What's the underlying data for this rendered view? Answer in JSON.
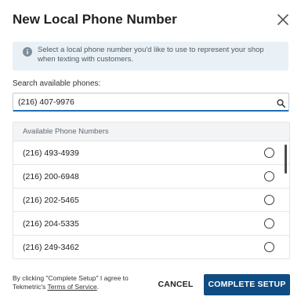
{
  "dialog": {
    "title": "New Local Phone Number",
    "close_icon": "close-icon"
  },
  "info": {
    "icon": "info-icon",
    "text": "Select a local phone number you'd like to use to represent your shop when texting with customers."
  },
  "search": {
    "label": "Search available phones:",
    "value": "(216) 407-9976",
    "icon": "search-icon"
  },
  "table": {
    "header": "Available Phone Numbers",
    "rows": [
      {
        "number": "(216) 493-4939",
        "selected": false
      },
      {
        "number": "(216) 200-6948",
        "selected": false
      },
      {
        "number": "(216) 202-5465",
        "selected": false
      },
      {
        "number": "(216) 204-5335",
        "selected": false
      },
      {
        "number": "(216) 249-3462",
        "selected": false
      }
    ]
  },
  "footer": {
    "agreement_prefix": "By clicking \"Complete Setup\" I agree to Tekmetric's ",
    "terms_link": "Terms of Service",
    "agreement_suffix": ".",
    "cancel_label": "CANCEL",
    "complete_label": "COMPLETE SETUP"
  },
  "colors": {
    "primary_button": "#0f4c81",
    "info_background": "#eaf1f6",
    "input_focus": "#1f6fb2"
  }
}
